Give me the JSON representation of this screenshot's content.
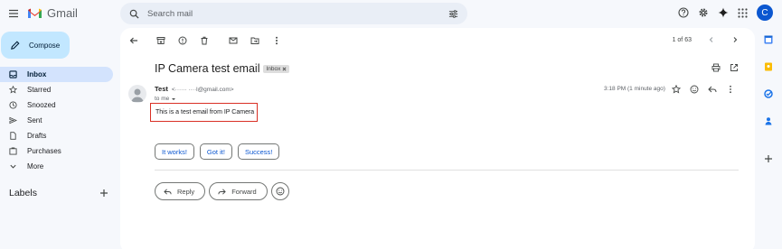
{
  "app": {
    "name": "Gmail"
  },
  "search": {
    "placeholder": "Search mail"
  },
  "account": {
    "avatar_initial": "C"
  },
  "compose": {
    "label": "Compose"
  },
  "nav": {
    "items": [
      {
        "label": "Inbox",
        "icon": "inbox-icon",
        "active": true
      },
      {
        "label": "Starred",
        "icon": "star-icon"
      },
      {
        "label": "Snoozed",
        "icon": "clock-icon"
      },
      {
        "label": "Sent",
        "icon": "send-icon"
      },
      {
        "label": "Drafts",
        "icon": "draft-icon"
      },
      {
        "label": "Purchases",
        "icon": "purchases-icon"
      },
      {
        "label": "More",
        "icon": "chevron-down-icon"
      }
    ],
    "labels_heading": "Labels"
  },
  "pager": {
    "text": "1 of 63"
  },
  "email": {
    "subject": "IP Camera test email",
    "chip": "Inbox",
    "sender_name": "Test",
    "sender_email": "<······ ····l@gmail.com>",
    "to": "to me",
    "time": "3:18 PM (1 minute ago)",
    "body": "This is a test email from IP Camera"
  },
  "smart_replies": [
    "It works!",
    "Got it!",
    "Success!"
  ],
  "actions": {
    "reply": "Reply",
    "forward": "Forward"
  },
  "colors": {
    "accent": "#0b57d0",
    "compose_bg": "#c2e7ff",
    "highlight_box": "#d93025"
  }
}
